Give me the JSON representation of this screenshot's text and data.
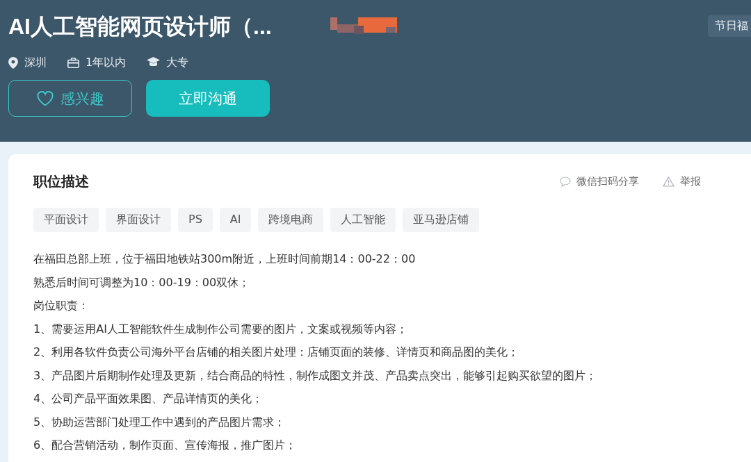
{
  "job": {
    "title": "AI人工智能网页设计师（...",
    "meta": [
      {
        "kind": "location",
        "label": "深圳"
      },
      {
        "kind": "experience",
        "label": "1年以内"
      },
      {
        "kind": "education",
        "label": "大专"
      }
    ],
    "benefit_tag": "节日福",
    "buttons": [
      {
        "kind": "interest",
        "label": "感兴趣"
      },
      {
        "kind": "chat",
        "label": "立即沟通"
      }
    ]
  },
  "description": {
    "title": "职位描述",
    "actions": [
      {
        "kind": "share",
        "label": "微信扫码分享"
      },
      {
        "kind": "report",
        "label": "举报"
      }
    ],
    "tags": [
      "平面设计",
      "界面设计",
      "PS",
      "AI",
      "跨境电商",
      "人工智能",
      "亚马逊店铺"
    ],
    "lines": [
      "在福田总部上班，位于福田地铁站300m附近，上班时间前期14：00-22：00",
      "熟悉后时间可调整为10：00-19：00双休；",
      "岗位职责：",
      "1、需要运用AI人工智能软件生成制作公司需要的图片，文案或视频等内容；",
      "2、利用各软件负责公司海外平台店铺的相关图片处理：店铺页面的装修、详情页和商品图的美化；",
      "3、产品图片后期制作处理及更新，结合商品的特性，制作成图文并茂、产品卖点突出，能够引起购买欲望的图片；",
      "4、公司产品平面效果图、产品详情页的美化；",
      "5、协助运营部门处理工作中遇到的产品图片需求；",
      "6、配合营销活动，制作页面、宣传海报，推广图片；"
    ]
  }
}
